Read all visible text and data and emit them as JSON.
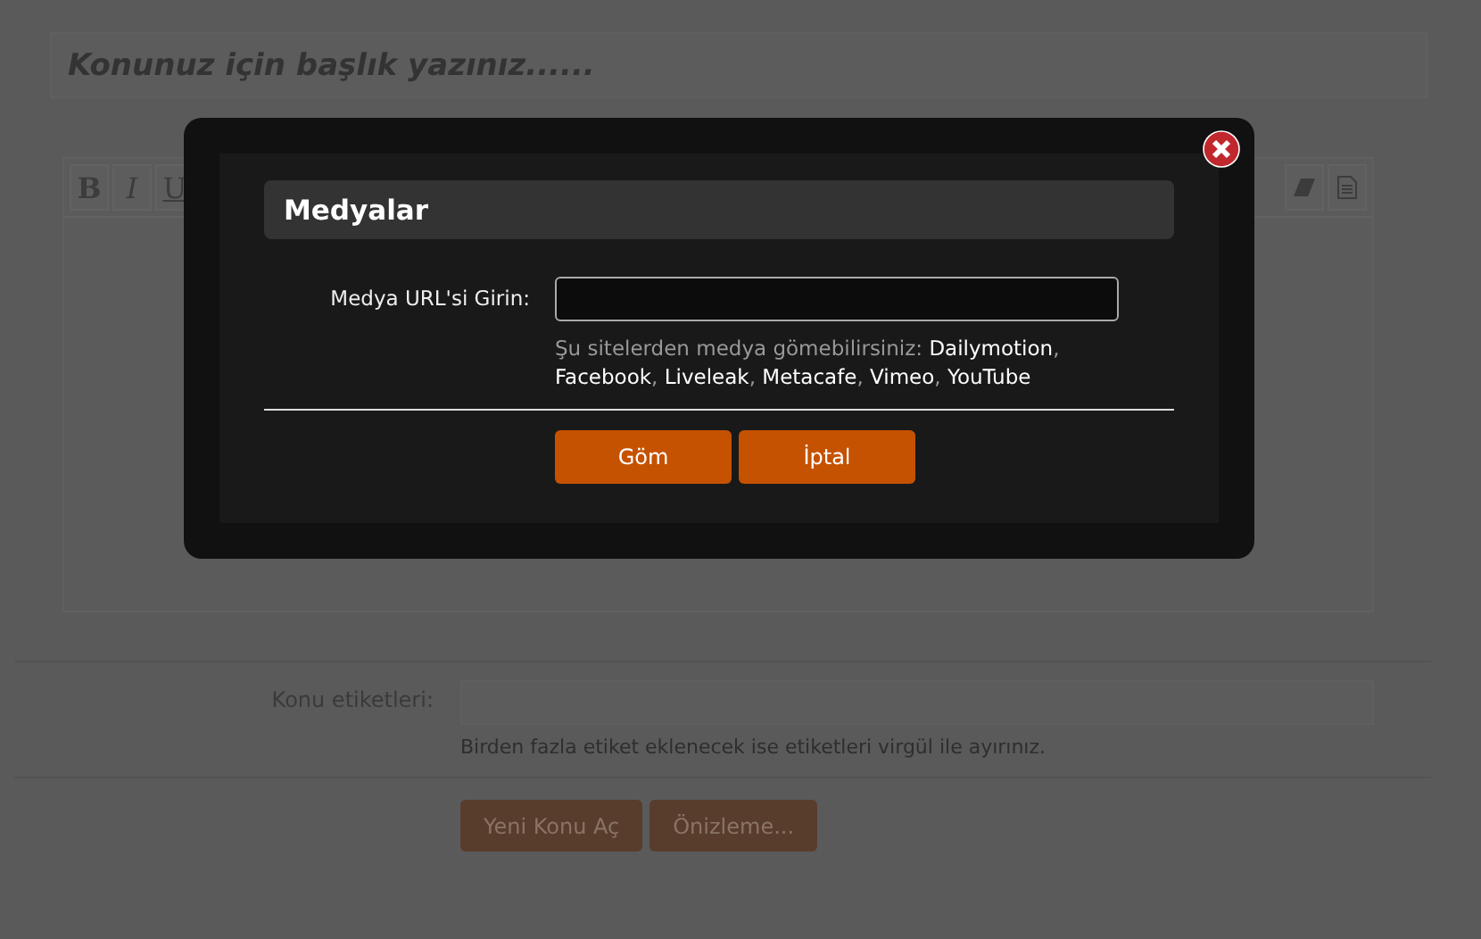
{
  "title_field": {
    "placeholder": "Konunuz için başlık yazınız......"
  },
  "toolbar": {
    "left": [
      {
        "kind": "bold",
        "label": "B"
      },
      {
        "kind": "italic",
        "label": "I"
      },
      {
        "kind": "underline",
        "label": "U"
      }
    ],
    "right": [
      {
        "kind": "eraser"
      },
      {
        "kind": "document"
      }
    ]
  },
  "tags": {
    "label": "Konu etiketleri:",
    "hint": "Birden fazla etiket eklenecek ise etiketleri virgül ile ayırınız."
  },
  "buttons": [
    "Yeni Konu Aç",
    "Önizleme..."
  ],
  "dialog": {
    "title": "Medyalar",
    "field_label": "Medya URL'si Girin:",
    "hint": "Şu sitelerden medya gömebilirsiniz: **Dailymotion**, **Facebook**, **Liveleak**, **Metacafe**, **Vimeo**, **YouTube**",
    "buttons": [
      "Göm",
      "İptal"
    ]
  }
}
